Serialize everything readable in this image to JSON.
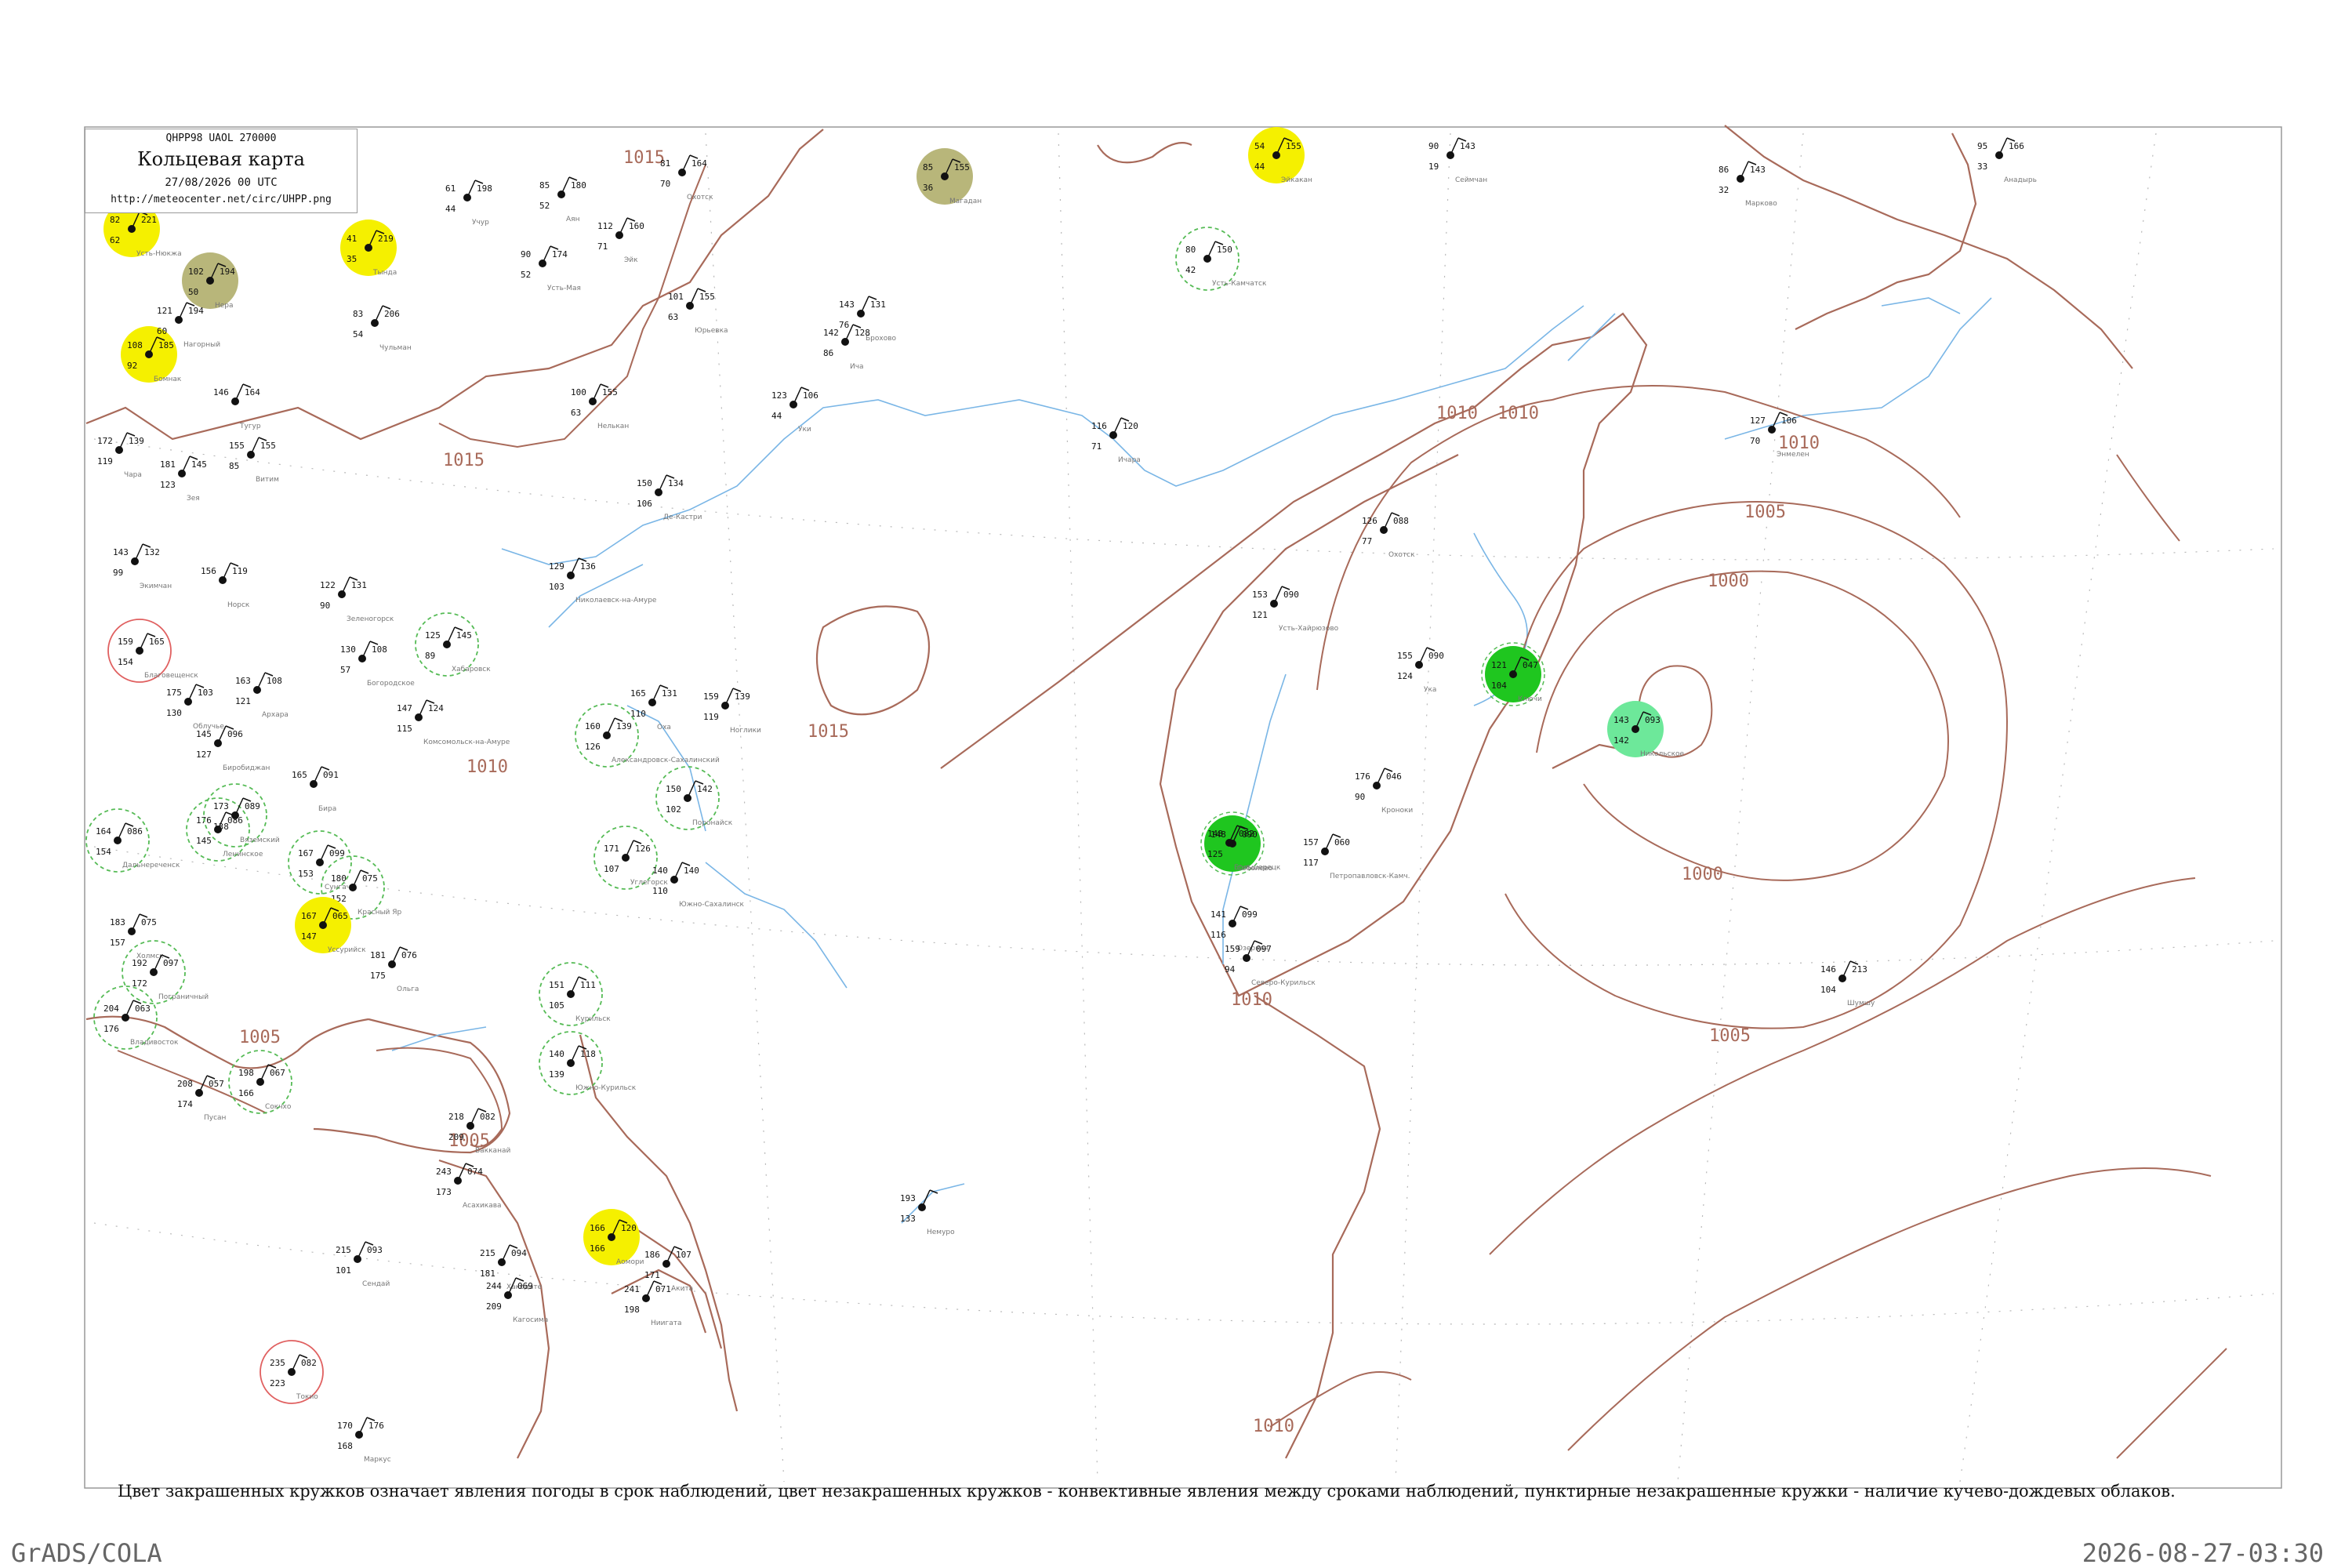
{
  "header": {
    "code": "QHPP98  UAOL  270000",
    "title": "Кольцевая карта",
    "time": "27/08/2026 00 UTC",
    "url": "http://meteocenter.net/circ/UHPP.png"
  },
  "caption": "Цвет закрашенных кружков означает явления погоды в срок наблюдений, цвет незакрашенных кружков - конвективные явления между сроками наблюдений, пунктирные незакрашенные кружки - наличие кучево-дождевых облаков.",
  "footer": {
    "left": "GrADS/COLA",
    "right": "2026-08-27-03:30"
  },
  "colors": {
    "isobar": "#a86a5a",
    "water": "#7ab6e6",
    "rain": "#1fc61f",
    "shower": "#6de89a",
    "drizzle_yellow": "#f5f000",
    "fog_olive": "#b8b67a",
    "thunder_ring": "#e06060",
    "cb_ring": "#55bb55"
  },
  "isobar_labels": [
    {
      "text": "1015"
    },
    {
      "text": "1015"
    },
    {
      "text": "1015"
    },
    {
      "text": "1010"
    },
    {
      "text": "1010"
    },
    {
      "text": "1010"
    },
    {
      "text": "1010"
    },
    {
      "text": "1005"
    },
    {
      "text": "1005"
    },
    {
      "text": "1005"
    },
    {
      "text": "1000"
    },
    {
      "text": "1000"
    },
    {
      "text": "1005"
    },
    {
      "text": "1010"
    },
    {
      "text": "1010"
    }
  ],
  "stations": [
    {
      "name": "Усть-Нюкжа",
      "t": "82",
      "p": "221",
      "dp": "62",
      "w": "yellow"
    },
    {
      "name": "Нера",
      "t": "102",
      "p": "194",
      "dp": "50",
      "w": "olive"
    },
    {
      "name": "Тында",
      "t": "41",
      "p": "219",
      "dp": "35",
      "w": "yellow"
    },
    {
      "name": "Бомнак",
      "t": "108",
      "p": "185",
      "dp": "92",
      "w": "yellow"
    },
    {
      "name": "Нагорный",
      "t": "121",
      "p": "194",
      "dp": "60",
      "w": "none"
    },
    {
      "name": "Чульман",
      "t": "83",
      "p": "206",
      "dp": "54",
      "w": "none"
    },
    {
      "name": "Учур",
      "t": "61",
      "p": "198",
      "dp": "44",
      "w": "none"
    },
    {
      "name": "Усть-Мая",
      "t": "90",
      "p": "174",
      "dp": "52",
      "w": "none"
    },
    {
      "name": "Аян",
      "t": "85",
      "p": "180",
      "dp": "52",
      "w": "none"
    },
    {
      "name": "Эйк",
      "t": "112",
      "p": "160",
      "dp": "71",
      "w": "none"
    },
    {
      "name": "Охотск",
      "t": "81",
      "p": "164",
      "dp": "70",
      "w": "none"
    },
    {
      "name": "Юрьевка",
      "t": "101",
      "p": "155",
      "dp": "63",
      "w": "none"
    },
    {
      "name": "Брохово",
      "t": "143",
      "p": "131",
      "dp": "76",
      "w": "none"
    },
    {
      "name": "Ича",
      "t": "142",
      "p": "128",
      "dp": "86",
      "w": "none"
    },
    {
      "name": "Уки",
      "t": "123",
      "p": "106",
      "dp": "44",
      "w": "none"
    },
    {
      "name": "Магадан",
      "t": "85",
      "p": "155",
      "dp": "36",
      "w": "olive"
    },
    {
      "name": "Эйкакан",
      "t": "54",
      "p": "155",
      "dp": "44",
      "w": "yellow"
    },
    {
      "name": "Усть-Камчатск",
      "t": "80",
      "p": "150",
      "dp": "42",
      "w": "cb"
    },
    {
      "name": "Сеймчан",
      "t": "90",
      "p": "143",
      "dp": "19",
      "w": "none"
    },
    {
      "name": "Марково",
      "t": "86",
      "p": "143",
      "dp": "32",
      "w": "none"
    },
    {
      "name": "Анадырь",
      "t": "95",
      "p": "166",
      "dp": "33",
      "w": "none"
    },
    {
      "name": "Энмелен",
      "t": "127",
      "p": "106",
      "dp": "70",
      "w": "none"
    },
    {
      "name": "Ичара",
      "t": "116",
      "p": "120",
      "dp": "71",
      "w": "none"
    },
    {
      "name": "Охотск",
      "t": "126",
      "p": "088",
      "dp": "77",
      "w": "none"
    },
    {
      "name": "Усть-Хайрюзово",
      "t": "153",
      "p": "090",
      "dp": "121",
      "w": "none"
    },
    {
      "name": "Соболево",
      "t": "148",
      "p": "090",
      "dp": "",
      "w": "rain"
    },
    {
      "name": "Ука",
      "t": "155",
      "p": "090",
      "dp": "124",
      "w": "none"
    },
    {
      "name": "Ключи",
      "t": "121",
      "p": "047",
      "dp": "104",
      "w": "rain"
    },
    {
      "name": "Никольское",
      "t": "143",
      "p": "093",
      "dp": "142",
      "w": "shower"
    },
    {
      "name": "Кроноки",
      "t": "176",
      "p": "046",
      "dp": "90",
      "w": "none"
    },
    {
      "name": "Петропавловск-Камч.",
      "t": "157",
      "p": "060",
      "dp": "117",
      "w": "none"
    },
    {
      "name": "Большерецк",
      "t": "148",
      "p": "082",
      "dp": "125",
      "w": "none"
    },
    {
      "name": "Озерная",
      "t": "141",
      "p": "099",
      "dp": "116",
      "w": "none"
    },
    {
      "name": "Шумшу",
      "t": "146",
      "p": "213",
      "dp": "104",
      "w": "none"
    },
    {
      "name": "Северо-Курильск",
      "t": "159",
      "p": "097",
      "dp": "94",
      "w": "none"
    },
    {
      "name": "Витим",
      "t": "155",
      "p": "155",
      "dp": "85",
      "w": "none"
    },
    {
      "name": "Чара",
      "t": "172",
      "p": "139",
      "dp": "119",
      "w": "none"
    },
    {
      "name": "Зея",
      "t": "181",
      "p": "145",
      "dp": "123",
      "w": "none"
    },
    {
      "name": "Тугур",
      "t": "146",
      "p": "164",
      "dp": "",
      "w": "none"
    },
    {
      "name": "Нелькан",
      "t": "100",
      "p": "155",
      "dp": "63",
      "w": "none"
    },
    {
      "name": "Де-Кастри",
      "t": "150",
      "p": "134",
      "dp": "106",
      "w": "none"
    },
    {
      "name": "Николаевск-на-Амуре",
      "t": "129",
      "p": "136",
      "dp": "103",
      "w": "none"
    },
    {
      "name": "Экимчан",
      "t": "143",
      "p": "132",
      "dp": "99",
      "w": "none"
    },
    {
      "name": "Норск",
      "t": "156",
      "p": "119",
      "dp": "",
      "w": "none"
    },
    {
      "name": "Зеленогорск",
      "t": "122",
      "p": "131",
      "dp": "90",
      "w": "none"
    },
    {
      "name": "Богородское",
      "t": "130",
      "p": "108",
      "dp": "57",
      "w": "none"
    },
    {
      "name": "Благовещенск",
      "t": "159",
      "p": "165",
      "dp": "154",
      "w": "thunder"
    },
    {
      "name": "Архара",
      "t": "163",
      "p": "108",
      "dp": "121",
      "w": "none"
    },
    {
      "name": "Хабаровск",
      "t": "125",
      "p": "145",
      "dp": "89",
      "w": "cb"
    },
    {
      "name": "Комсомольск-на-Амуре",
      "t": "147",
      "p": "124",
      "dp": "115",
      "w": "none"
    },
    {
      "name": "Оха",
      "t": "165",
      "p": "131",
      "dp": "110",
      "w": "none"
    },
    {
      "name": "Ноглики",
      "t": "159",
      "p": "139",
      "dp": "119",
      "w": "none"
    },
    {
      "name": "Александровск-Сахалинский",
      "t": "160",
      "p": "139",
      "dp": "126",
      "w": "cb"
    },
    {
      "name": "Поронайск",
      "t": "150",
      "p": "142",
      "dp": "102",
      "w": "cb"
    },
    {
      "name": "Облучье",
      "t": "175",
      "p": "103",
      "dp": "130",
      "w": "none"
    },
    {
      "name": "Биробиджан",
      "t": "145",
      "p": "096",
      "dp": "127",
      "w": "none"
    },
    {
      "name": "Бира",
      "t": "165",
      "p": "091",
      "dp": "",
      "w": "none"
    },
    {
      "name": "Ленинское",
      "t": "176",
      "p": "086",
      "dp": "145",
      "w": "cb"
    },
    {
      "name": "Вяземский",
      "t": "173",
      "p": "089",
      "dp": "138",
      "w": "cb"
    },
    {
      "name": "Дальнереченск",
      "t": "164",
      "p": "086",
      "dp": "154",
      "w": "cb"
    },
    {
      "name": "Сунгач",
      "t": "167",
      "p": "099",
      "dp": "153",
      "w": "cb"
    },
    {
      "name": "Красный Яр",
      "t": "180",
      "p": "075",
      "dp": "152",
      "w": "cb"
    },
    {
      "name": "Углегорск",
      "t": "171",
      "p": "126",
      "dp": "107",
      "w": "cb"
    },
    {
      "name": "Южно-Сахалинск",
      "t": "140",
      "p": "140",
      "dp": "110",
      "w": "none"
    },
    {
      "name": "Холмск",
      "t": "183",
      "p": "075",
      "dp": "157",
      "w": "none"
    },
    {
      "name": "Пограничный",
      "t": "192",
      "p": "097",
      "dp": "172",
      "w": "cb"
    },
    {
      "name": "Владивосток",
      "t": "204",
      "p": "063",
      "dp": "176",
      "w": "cb"
    },
    {
      "name": "Уссурийск",
      "t": "167",
      "p": "065",
      "dp": "147",
      "w": "yellow"
    },
    {
      "name": "Ольга",
      "t": "181",
      "p": "076",
      "dp": "175",
      "w": "none"
    },
    {
      "name": "Курильск",
      "t": "151",
      "p": "111",
      "dp": "105",
      "w": "cb"
    },
    {
      "name": "Южно-Курильск",
      "t": "140",
      "p": "118",
      "dp": "139",
      "w": "cb"
    },
    {
      "name": "Пусан",
      "t": "208",
      "p": "057",
      "dp": "174",
      "w": "none"
    },
    {
      "name": "Сокчхо",
      "t": "198",
      "p": "067",
      "dp": "166",
      "w": "cb"
    },
    {
      "name": "Вакканай",
      "t": "218",
      "p": "082",
      "dp": "209",
      "w": "none"
    },
    {
      "name": "Асахикава",
      "t": "243",
      "p": "074",
      "dp": "173",
      "w": "none"
    },
    {
      "name": "Немуро",
      "t": "193",
      "p": "",
      "dp": "133",
      "w": "none"
    },
    {
      "name": "Хакодате",
      "t": "215",
      "p": "094",
      "dp": "181",
      "w": "none"
    },
    {
      "name": "Аомори",
      "t": "166",
      "p": "120",
      "dp": "166",
      "w": "yellow"
    },
    {
      "name": "Акита",
      "t": "186",
      "p": "107",
      "dp": "171",
      "w": "none"
    },
    {
      "name": "Ниигата",
      "t": "241",
      "p": "071",
      "dp": "198",
      "w": "none"
    },
    {
      "name": "Сендай",
      "t": "215",
      "p": "093",
      "dp": "101",
      "w": "none"
    },
    {
      "name": "Кагосима",
      "t": "244",
      "p": "069",
      "dp": "209",
      "w": "none"
    },
    {
      "name": "Токио",
      "t": "235",
      "p": "082",
      "dp": "223",
      "w": "thunder"
    },
    {
      "name": "Маркус",
      "t": "170",
      "p": "176",
      "dp": "168",
      "w": "none"
    }
  ]
}
